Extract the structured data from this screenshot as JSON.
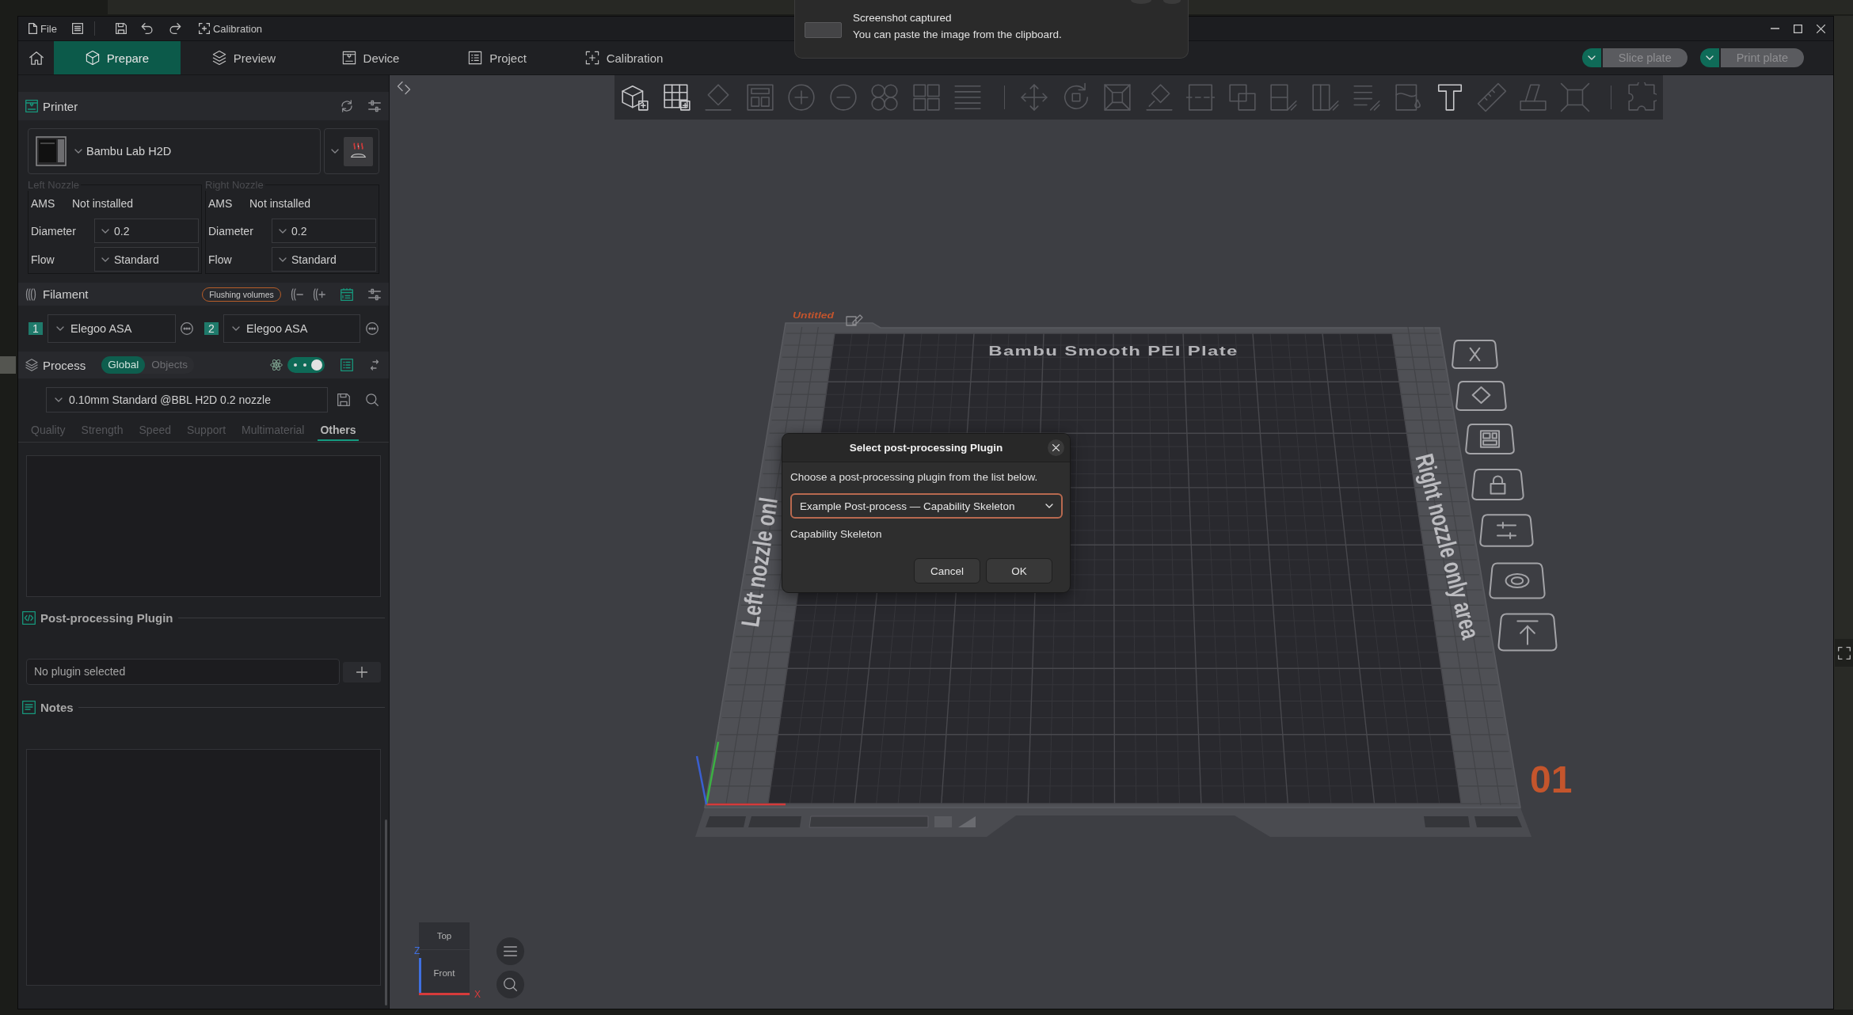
{
  "notification": {
    "title": "Screenshot captured",
    "body": "You can paste the image from the clipboard."
  },
  "title_bar": {
    "menu": "File",
    "calibration": "Calibration"
  },
  "tabs": [
    {
      "label": "Prepare",
      "selected": true
    },
    {
      "label": "Preview",
      "selected": false
    },
    {
      "label": "Device",
      "selected": false
    },
    {
      "label": "Project",
      "selected": false
    },
    {
      "label": "Calibration",
      "selected": false
    }
  ],
  "plate_actions": [
    {
      "label": "Slice plate",
      "disabled": true
    },
    {
      "label": "Print plate",
      "disabled": true
    }
  ],
  "sidebar": {
    "printer": {
      "title": "Printer",
      "model": "Bambu Lab H2D",
      "nozzles": [
        {
          "title": "Left Nozzle",
          "ams_label": "AMS",
          "ams": "Not installed",
          "diameter_label": "Diameter",
          "diameter": "0.2",
          "flow_label": "Flow",
          "flow": "Standard"
        },
        {
          "title": "Right Nozzle",
          "ams_label": "AMS",
          "ams": "Not installed",
          "diameter_label": "Diameter",
          "diameter": "0.2",
          "flow_label": "Flow",
          "flow": "Standard"
        }
      ]
    },
    "filament": {
      "title": "Filament",
      "flushing_button": "Flushing volumes",
      "slots": [
        {
          "number": "1",
          "name": "Elegoo ASA",
          "color": "#1f7a6b"
        },
        {
          "number": "2",
          "name": "Elegoo ASA",
          "color": "#1f7a6b"
        }
      ]
    },
    "process": {
      "title": "Process",
      "scope": [
        {
          "label": "Global",
          "selected": true
        },
        {
          "label": "Objects",
          "selected": false
        }
      ],
      "advanced": true,
      "preset": "0.10mm Standard @BBL H2D 0.2 nozzle",
      "tabs": [
        {
          "label": "Quality",
          "selected": false
        },
        {
          "label": "Strength",
          "selected": false
        },
        {
          "label": "Speed",
          "selected": false
        },
        {
          "label": "Support",
          "selected": false
        },
        {
          "label": "Multimaterial",
          "selected": false
        },
        {
          "label": "Others",
          "selected": true
        }
      ]
    },
    "post_processing": {
      "title": "Post-processing Plugin",
      "value": "No plugin selected"
    },
    "notes": {
      "title": "Notes"
    }
  },
  "toolbar": [
    {
      "items": [
        {
          "kind": "add-object",
          "disabled": false
        },
        {
          "kind": "add-plate",
          "disabled": false
        },
        {
          "kind": "auto-orient",
          "disabled": true
        },
        {
          "kind": "arrange",
          "disabled": true
        },
        {
          "kind": "add-instance",
          "disabled": true
        },
        {
          "kind": "remove-instance",
          "disabled": true
        },
        {
          "kind": "split-objects",
          "disabled": true
        },
        {
          "kind": "split-parts",
          "disabled": true
        },
        {
          "kind": "layers",
          "disabled": true
        }
      ]
    },
    {
      "items": [
        {
          "kind": "move",
          "disabled": true
        },
        {
          "kind": "rotate",
          "disabled": true
        },
        {
          "kind": "scale",
          "disabled": true
        },
        {
          "kind": "lay-on-face",
          "disabled": true
        },
        {
          "kind": "cut",
          "disabled": true
        },
        {
          "kind": "boolean",
          "disabled": true
        },
        {
          "kind": "support-paint",
          "disabled": true
        },
        {
          "kind": "seam-paint",
          "disabled": true
        },
        {
          "kind": "fuzzy-skin",
          "disabled": true
        },
        {
          "kind": "color-paint",
          "disabled": true
        },
        {
          "kind": "text",
          "disabled": false
        },
        {
          "kind": "measure",
          "disabled": true
        },
        {
          "kind": "assembly",
          "disabled": true
        },
        {
          "kind": "brim-ears",
          "disabled": true
        }
      ]
    },
    {
      "items": [
        {
          "kind": "variable-layer",
          "disabled": true
        }
      ]
    }
  ],
  "plate": {
    "name": "Untitled",
    "surface": "Bambu Smooth PEI Plate",
    "left_area": "Left nozzle onl",
    "right_area": "Right nozzle only area",
    "number": "01"
  },
  "view_cube": {
    "top": "Top",
    "front": "Front",
    "axes": [
      {
        "label": "Z",
        "color": "#3f6fe0"
      },
      {
        "label": "X",
        "color": "#d63b3b"
      }
    ]
  },
  "dialog": {
    "title": "Select post-processing Plugin",
    "message": "Choose a post-processing plugin from the list below.",
    "select": {
      "value": "Example Post-process — Capability Skeleton",
      "focused": true
    },
    "description": "Capability Skeleton",
    "buttons": [
      "Cancel",
      "OK"
    ]
  }
}
